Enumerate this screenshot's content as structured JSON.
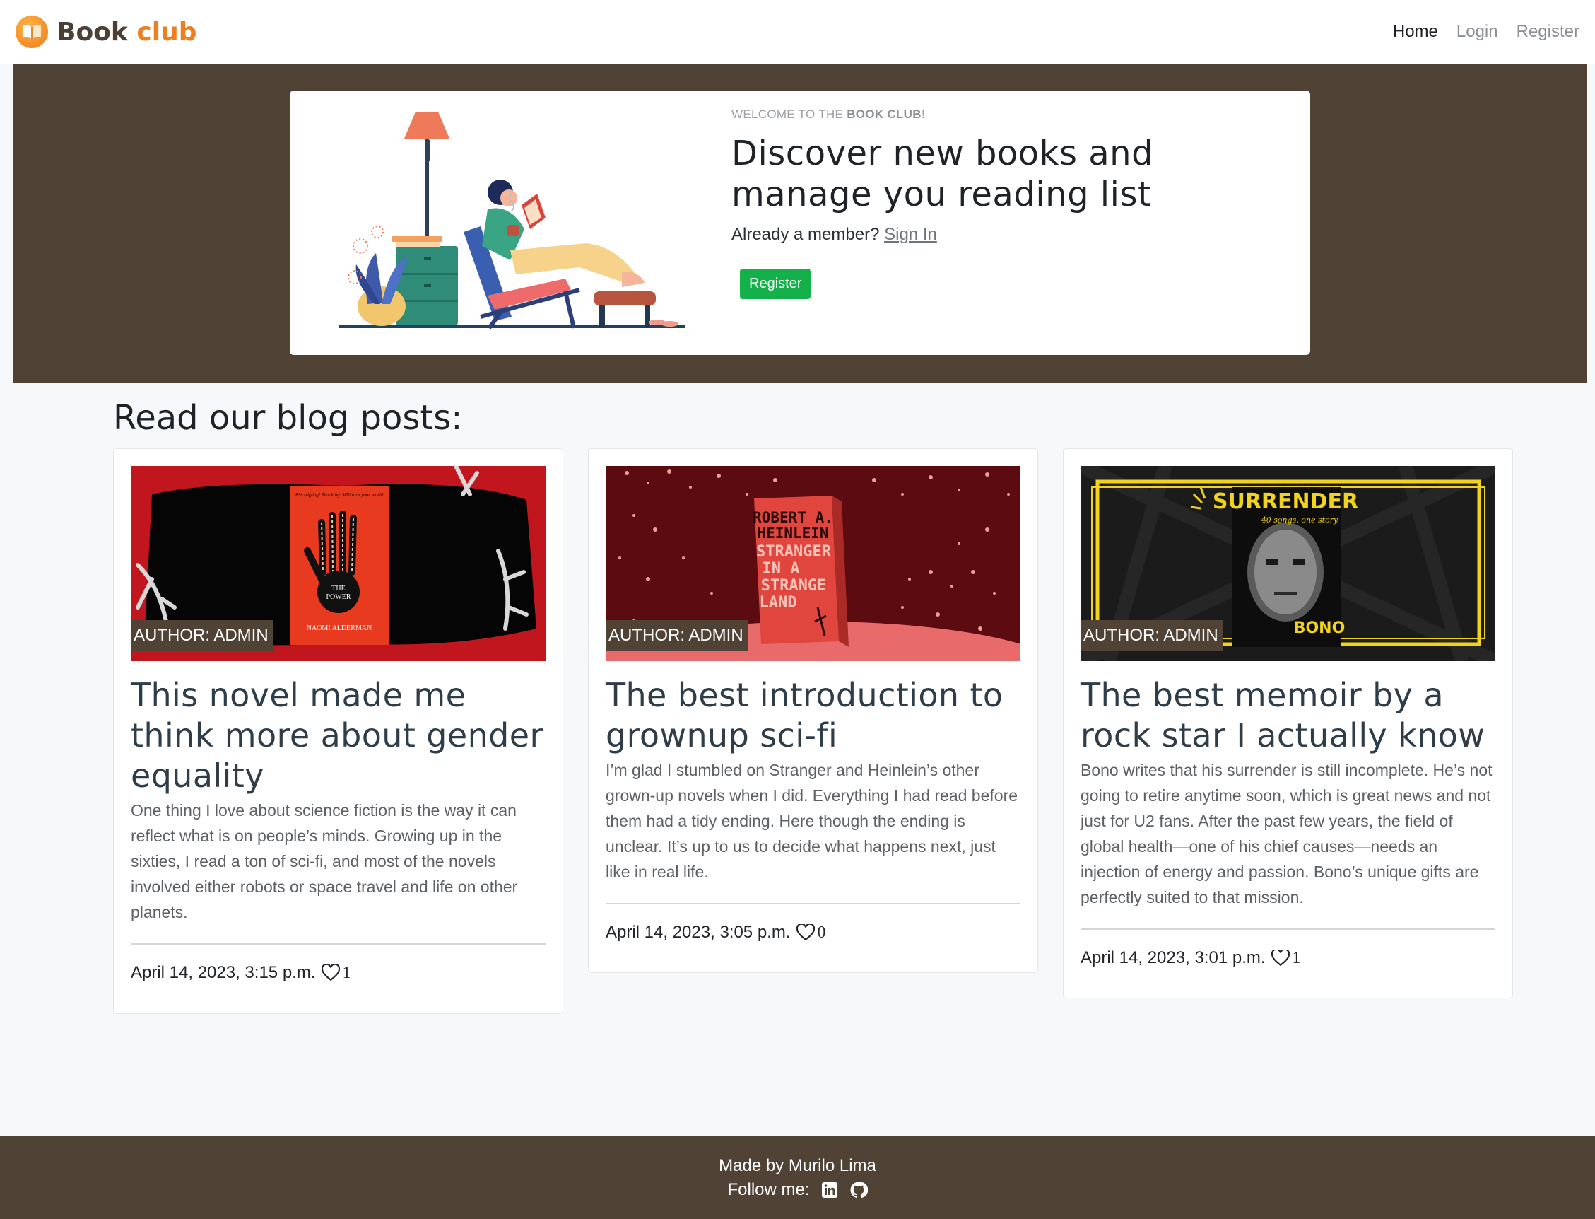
{
  "brand": {
    "name_part1": "Book",
    "name_part2": "club",
    "logo_icon": "open-book-icon"
  },
  "nav": {
    "home": "Home",
    "login": "Login",
    "register": "Register"
  },
  "hero": {
    "kicker_prefix": "WELCOME TO THE ",
    "kicker_bold": "BOOK CLUB",
    "kicker_suffix": "!",
    "title": "Discover new books and manage you reading list",
    "member_text": "Already a member?",
    "sign_in": "Sign In",
    "register_button": "Register"
  },
  "blog": {
    "section_title": "Read our blog posts:",
    "posts": [
      {
        "author": "AUTHOR: ADMIN",
        "title": "This novel made me think more about gender equality",
        "excerpt": "One thing I love about science fiction is the way it can reflect what is on people’s minds. Growing up in the sixties, I read a ton of sci-fi, and most of the novels involved either robots or space travel and life on other planets.",
        "date": "April 14, 2023, 3:15 p.m.",
        "likes": "1",
        "cover_title": "THE POWER",
        "cover_author": "NAOMI ALDERMAN"
      },
      {
        "author": "AUTHOR: ADMIN",
        "title": "The best introduction to grownup sci-fi",
        "excerpt": "I’m glad I stumbled on Stranger and Heinlein’s other grown-up novels when I did. Everything I had read before them had a tidy ending. Here though the ending is unclear. It’s up to us to decide what happens next, just like in real life.",
        "date": "April 14, 2023, 3:05 p.m.",
        "likes": "0",
        "cover_author": "ROBERT A. HEINLEIN",
        "cover_title": "STRANGER IN A STRANGE LAND"
      },
      {
        "author": "AUTHOR: ADMIN",
        "title": "The best memoir by a rock star I actually know",
        "excerpt": "Bono writes that his surrender is still incomplete. He’s not going to retire anytime soon, which is great news and not just for U2 fans. After the past few years, the field of global health—one of his chief causes—needs an injection of energy and passion. Bono’s unique gifts are perfectly suited to that mission.",
        "date": "April 14, 2023, 3:01 p.m.",
        "likes": "1",
        "cover_title": "SURRENDER",
        "cover_subtitle": "40 songs, one story",
        "cover_author": "BONO"
      }
    ]
  },
  "footer": {
    "made_by": "Made by Murilo Lima",
    "follow": "Follow me:",
    "icons": [
      "linkedin-icon",
      "github-icon"
    ]
  },
  "colors": {
    "brown": "#514236",
    "accent_orange": "#ee7f1e",
    "green": "#14b14b"
  }
}
